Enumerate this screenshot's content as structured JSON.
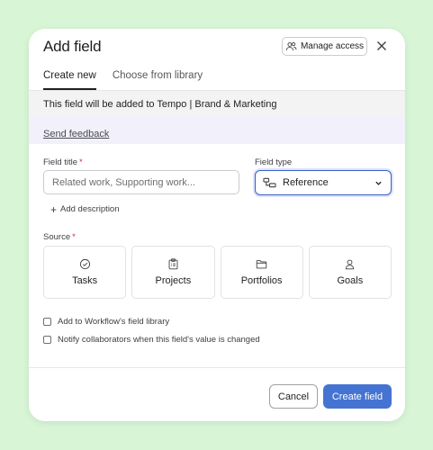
{
  "dialog": {
    "title": "Add field",
    "manage_access_label": "Manage access",
    "close_label": "Close"
  },
  "tabs": [
    {
      "label": "Create new",
      "active": true
    },
    {
      "label": "Choose from library",
      "active": false
    }
  ],
  "banner": {
    "text": "This field will be added to Tempo | Brand & Marketing"
  },
  "feedback": {
    "label": "Send feedback"
  },
  "form": {
    "field_title_label": "Field title",
    "required_marker": "*",
    "field_title_placeholder": "Related work, Supporting work...",
    "field_title_value": "",
    "field_type_label": "Field type",
    "field_type_value": "Reference",
    "add_description_label": "Add description",
    "source_label": "Source",
    "sources": [
      {
        "label": "Tasks",
        "icon": "check-circle-icon"
      },
      {
        "label": "Projects",
        "icon": "clipboard-icon"
      },
      {
        "label": "Portfolios",
        "icon": "folder-icon"
      },
      {
        "label": "Goals",
        "icon": "person-icon"
      }
    ],
    "checkboxes": [
      {
        "label": "Add to Workflow's field library",
        "checked": false
      },
      {
        "label": "Notify collaborators when this field's value is changed",
        "checked": false
      }
    ]
  },
  "footer": {
    "cancel_label": "Cancel",
    "create_label": "Create field"
  },
  "colors": {
    "background": "#d8f5d6",
    "primary": "#4573d2",
    "focus_border": "#3b5ec8",
    "feedback_bg": "#f1f0fb",
    "required": "#c92f54"
  }
}
